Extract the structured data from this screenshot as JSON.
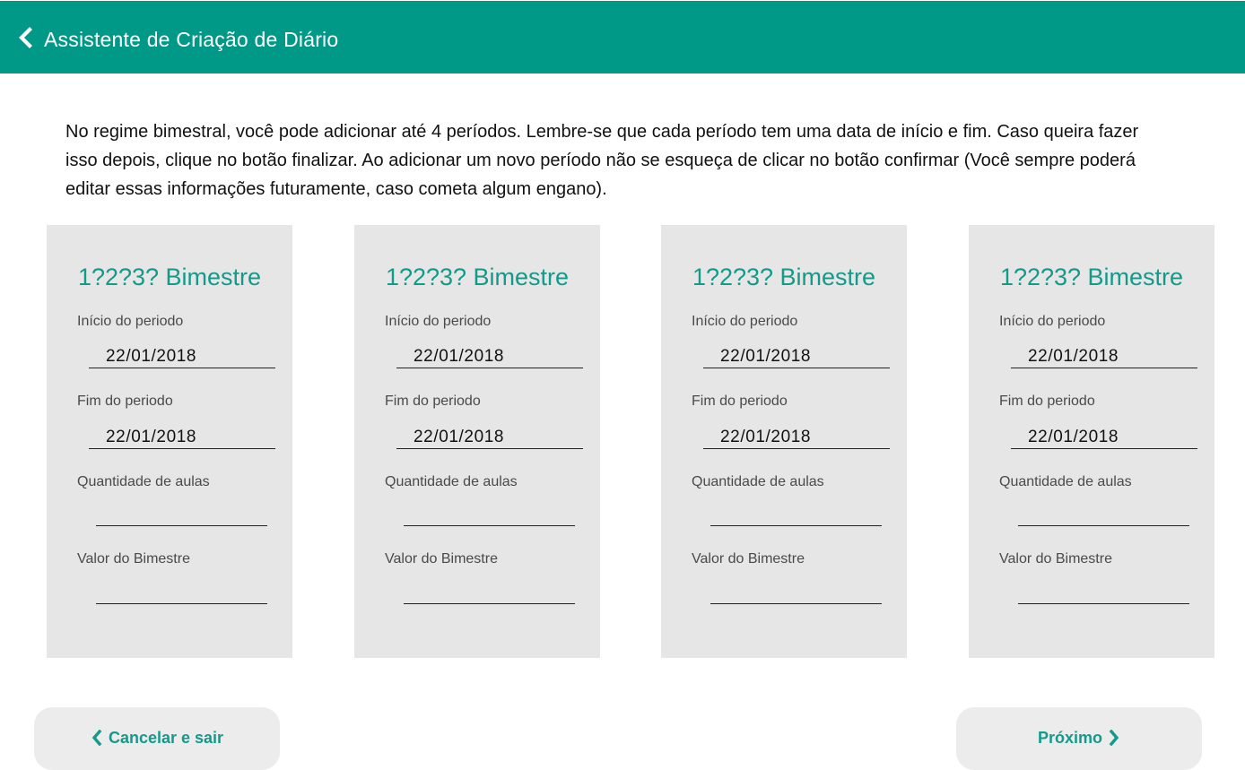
{
  "header": {
    "title": "Assistente de Criação de Diário",
    "back_icon": "chevron-left-icon"
  },
  "intro": {
    "lines": [
      "No regime bimestral, você pode adicionar até 4 períodos. Lembre-se que cada período tem uma data de início e fim. Caso queira fazer",
      "isso depois, clique no botão finalizar. Ao adicionar um novo período não se esqueça de clicar no botão confirmar (Você sempre poderá",
      "editar essas informações futuramente, caso cometa algum engano)."
    ]
  },
  "periods": [
    {
      "title": "1?2?3? Bimestre",
      "start_label": "Início do periodo",
      "start_value": "22/01/2018",
      "end_label": "Fim do periodo",
      "end_value": "22/01/2018",
      "classes_label": "Quantidade de aulas",
      "classes_value": "",
      "value_label": "Valor do Bimestre",
      "value_value": ""
    },
    {
      "title": "1?2?3? Bimestre",
      "start_label": "Início do periodo",
      "start_value": "22/01/2018",
      "end_label": "Fim do periodo",
      "end_value": "22/01/2018",
      "classes_label": "Quantidade de aulas",
      "classes_value": "",
      "value_label": "Valor do Bimestre",
      "value_value": ""
    },
    {
      "title": "1?2?3? Bimestre",
      "start_label": "Início do periodo",
      "start_value": "22/01/2018",
      "end_label": "Fim do periodo",
      "end_value": "22/01/2018",
      "classes_label": "Quantidade de aulas",
      "classes_value": "",
      "value_label": "Valor do Bimestre",
      "value_value": ""
    },
    {
      "title": "1?2?3? Bimestre",
      "start_label": "Início do periodo",
      "start_value": "22/01/2018",
      "end_label": "Fim do periodo",
      "end_value": "22/01/2018",
      "classes_label": "Quantidade de aulas",
      "classes_value": "",
      "value_label": "Valor do Bimestre",
      "value_value": ""
    }
  ],
  "footer": {
    "cancel_label": "Cancelar e sair",
    "cancel_icon": "chevron-left-icon",
    "next_label": "Próximo",
    "next_icon": "chevron-right-icon"
  },
  "colors": {
    "header_bg": "#009887",
    "accent": "#149a8a",
    "card_bg": "#e6e6e6",
    "button_bg": "#ececec"
  }
}
